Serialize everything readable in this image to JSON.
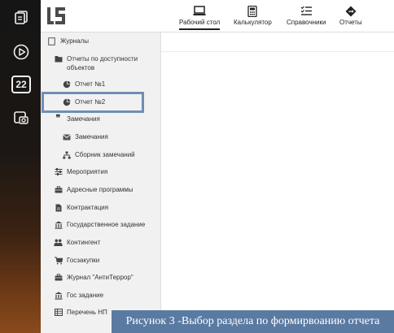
{
  "launcher": {
    "icons": [
      "documents-icon",
      "play-icon",
      "calendar-badge-icon",
      "camera-icon"
    ],
    "badge_number": "22"
  },
  "topbar": {
    "nav": [
      {
        "label": "Рабочий стол",
        "icon": "desktop-icon",
        "active": true
      },
      {
        "label": "Калькулятор",
        "icon": "calculator-icon"
      },
      {
        "label": "Справочники",
        "icon": "list-icon"
      },
      {
        "label": "Отчеты",
        "icon": "diamond-arrow-icon"
      }
    ]
  },
  "sidebar": {
    "items": [
      {
        "label": "Журналы",
        "icon": "document-icon"
      },
      {
        "label": "Отчеты по доступности объектов",
        "icon": "folder-icon"
      },
      {
        "label": "Отчет №1",
        "icon": "pie-chart-icon"
      },
      {
        "label": "Отчет №2",
        "icon": "pie-chart-icon"
      },
      {
        "label": "Замечания",
        "icon": "quote-icon"
      },
      {
        "label": "Замечания",
        "icon": "envelope-icon"
      },
      {
        "label": "Сборник замечаний",
        "icon": "sitemap-icon"
      },
      {
        "label": "Мероприятия",
        "icon": "sliders-icon"
      },
      {
        "label": "Адресные программы",
        "icon": "briefcase-icon"
      },
      {
        "label": "Контрактация",
        "icon": "file-icon"
      },
      {
        "label": "Государственное задание",
        "icon": "institution-icon"
      },
      {
        "label": "Контингент",
        "icon": "users-icon"
      },
      {
        "label": "Госзакупки",
        "icon": "cart-icon"
      },
      {
        "label": "Журнал \"АнтиТеррор\"",
        "icon": "briefcase-icon"
      },
      {
        "label": "Гос задание",
        "icon": "institution-icon"
      },
      {
        "label": "Перечень НП",
        "icon": "table-icon"
      }
    ]
  },
  "caption": "Рисунок 3 -Выбор раздела по формирвоанию отчета",
  "colors": {
    "highlight": "#6e8fb5",
    "caption_bg": "#5a7aa2",
    "sidebar_bg": "#f1f1f1"
  }
}
